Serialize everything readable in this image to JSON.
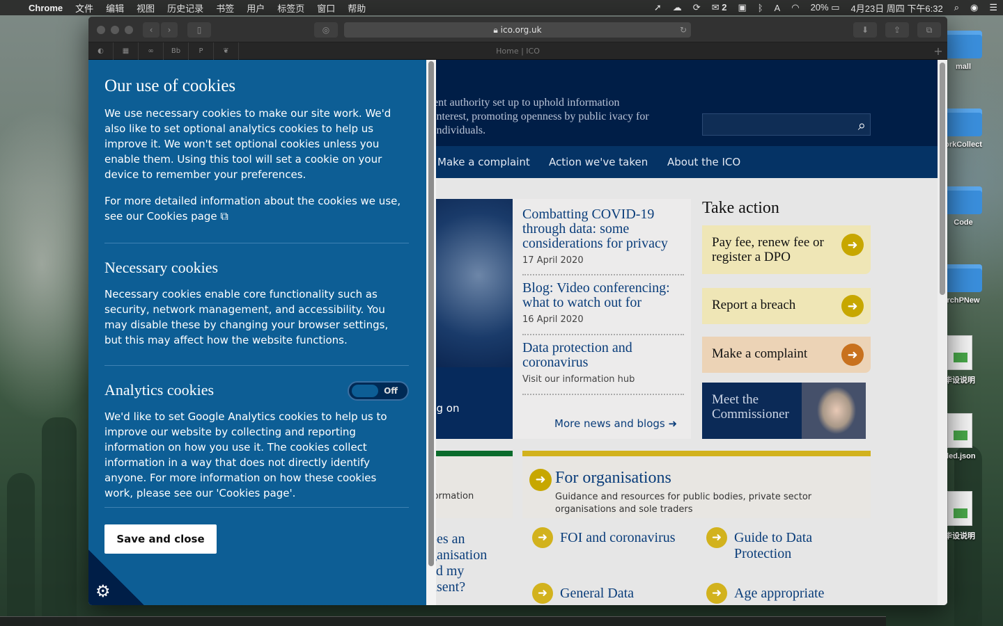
{
  "menubar": {
    "app": "Chrome",
    "items": [
      "文件",
      "编辑",
      "视图",
      "历史记录",
      "书签",
      "用户",
      "标签页",
      "窗口",
      "帮助"
    ],
    "wechat_count": "2",
    "battery": "20%",
    "clock": "4月23日 周四 下午6:32"
  },
  "desktop": {
    "icons": [
      "mall",
      "orkCollect",
      "Code",
      "rchPNew",
      "毕设说明",
      "tled.json",
      "毕设说明"
    ]
  },
  "browser": {
    "url": "ico.org.uk",
    "tab_title": "Home | ICO",
    "favicons": [
      "github",
      "qr",
      "link",
      "Bb",
      "P",
      "bird"
    ]
  },
  "site": {
    "tagline": "ent authority set up to uphold information interest, promoting openness by public ivacy for individuals.",
    "nav": [
      "Make a complaint",
      "Action we've taken",
      "About the ICO"
    ],
    "image_caption": "ng on",
    "news": [
      {
        "title": "Combatting COVID-19 through data: some considerations for privacy",
        "date": "17 April 2020"
      },
      {
        "title": "Blog: Video conferencing: what to watch out for",
        "date": "16 April 2020"
      },
      {
        "title": "Data protection and coronavirus",
        "date": "Visit our information hub"
      }
    ],
    "more_news": "More news and blogs",
    "take_action": {
      "title": "Take action",
      "cards": [
        "Pay fee, renew fee or register a DPO",
        "Report a breach",
        "Make a complaint"
      ],
      "meet": "Meet the Commissioner"
    },
    "left_col_text": "formation",
    "org": {
      "title": "For organisations",
      "desc": "Guidance and resources for public bodies, private sector organisations and sole traders"
    },
    "links": [
      "FOI and coronavirus",
      "Guide to Data Protection",
      "General Data",
      "Age appropriate"
    ],
    "left_question": "oes an ganisation ed my nsent?"
  },
  "cookie": {
    "title": "Our use of cookies",
    "intro": "We use necessary cookies to make our site work. We'd also like to set optional analytics cookies to help us improve it. We won't set optional cookies unless you enable them. Using this tool will set a cookie on your device to remember your preferences.",
    "more_info": "For more detailed information about the cookies we use, see our Cookies page",
    "necessary_title": "Necessary cookies",
    "necessary_text": "Necessary cookies enable core functionality such as security, network management, and accessibility. You may disable these by changing your browser settings, but this may affect how the website functions.",
    "analytics_title": "Analytics cookies",
    "analytics_toggle": "Off",
    "analytics_text": "We'd like to set Google Analytics cookies to help us to improve our website by collecting and reporting information on how you use it. The cookies collect information in a way that does not directly identify anyone. For more information on how these cookies work, please see our 'Cookies page'.",
    "save_label": "Save and close"
  }
}
